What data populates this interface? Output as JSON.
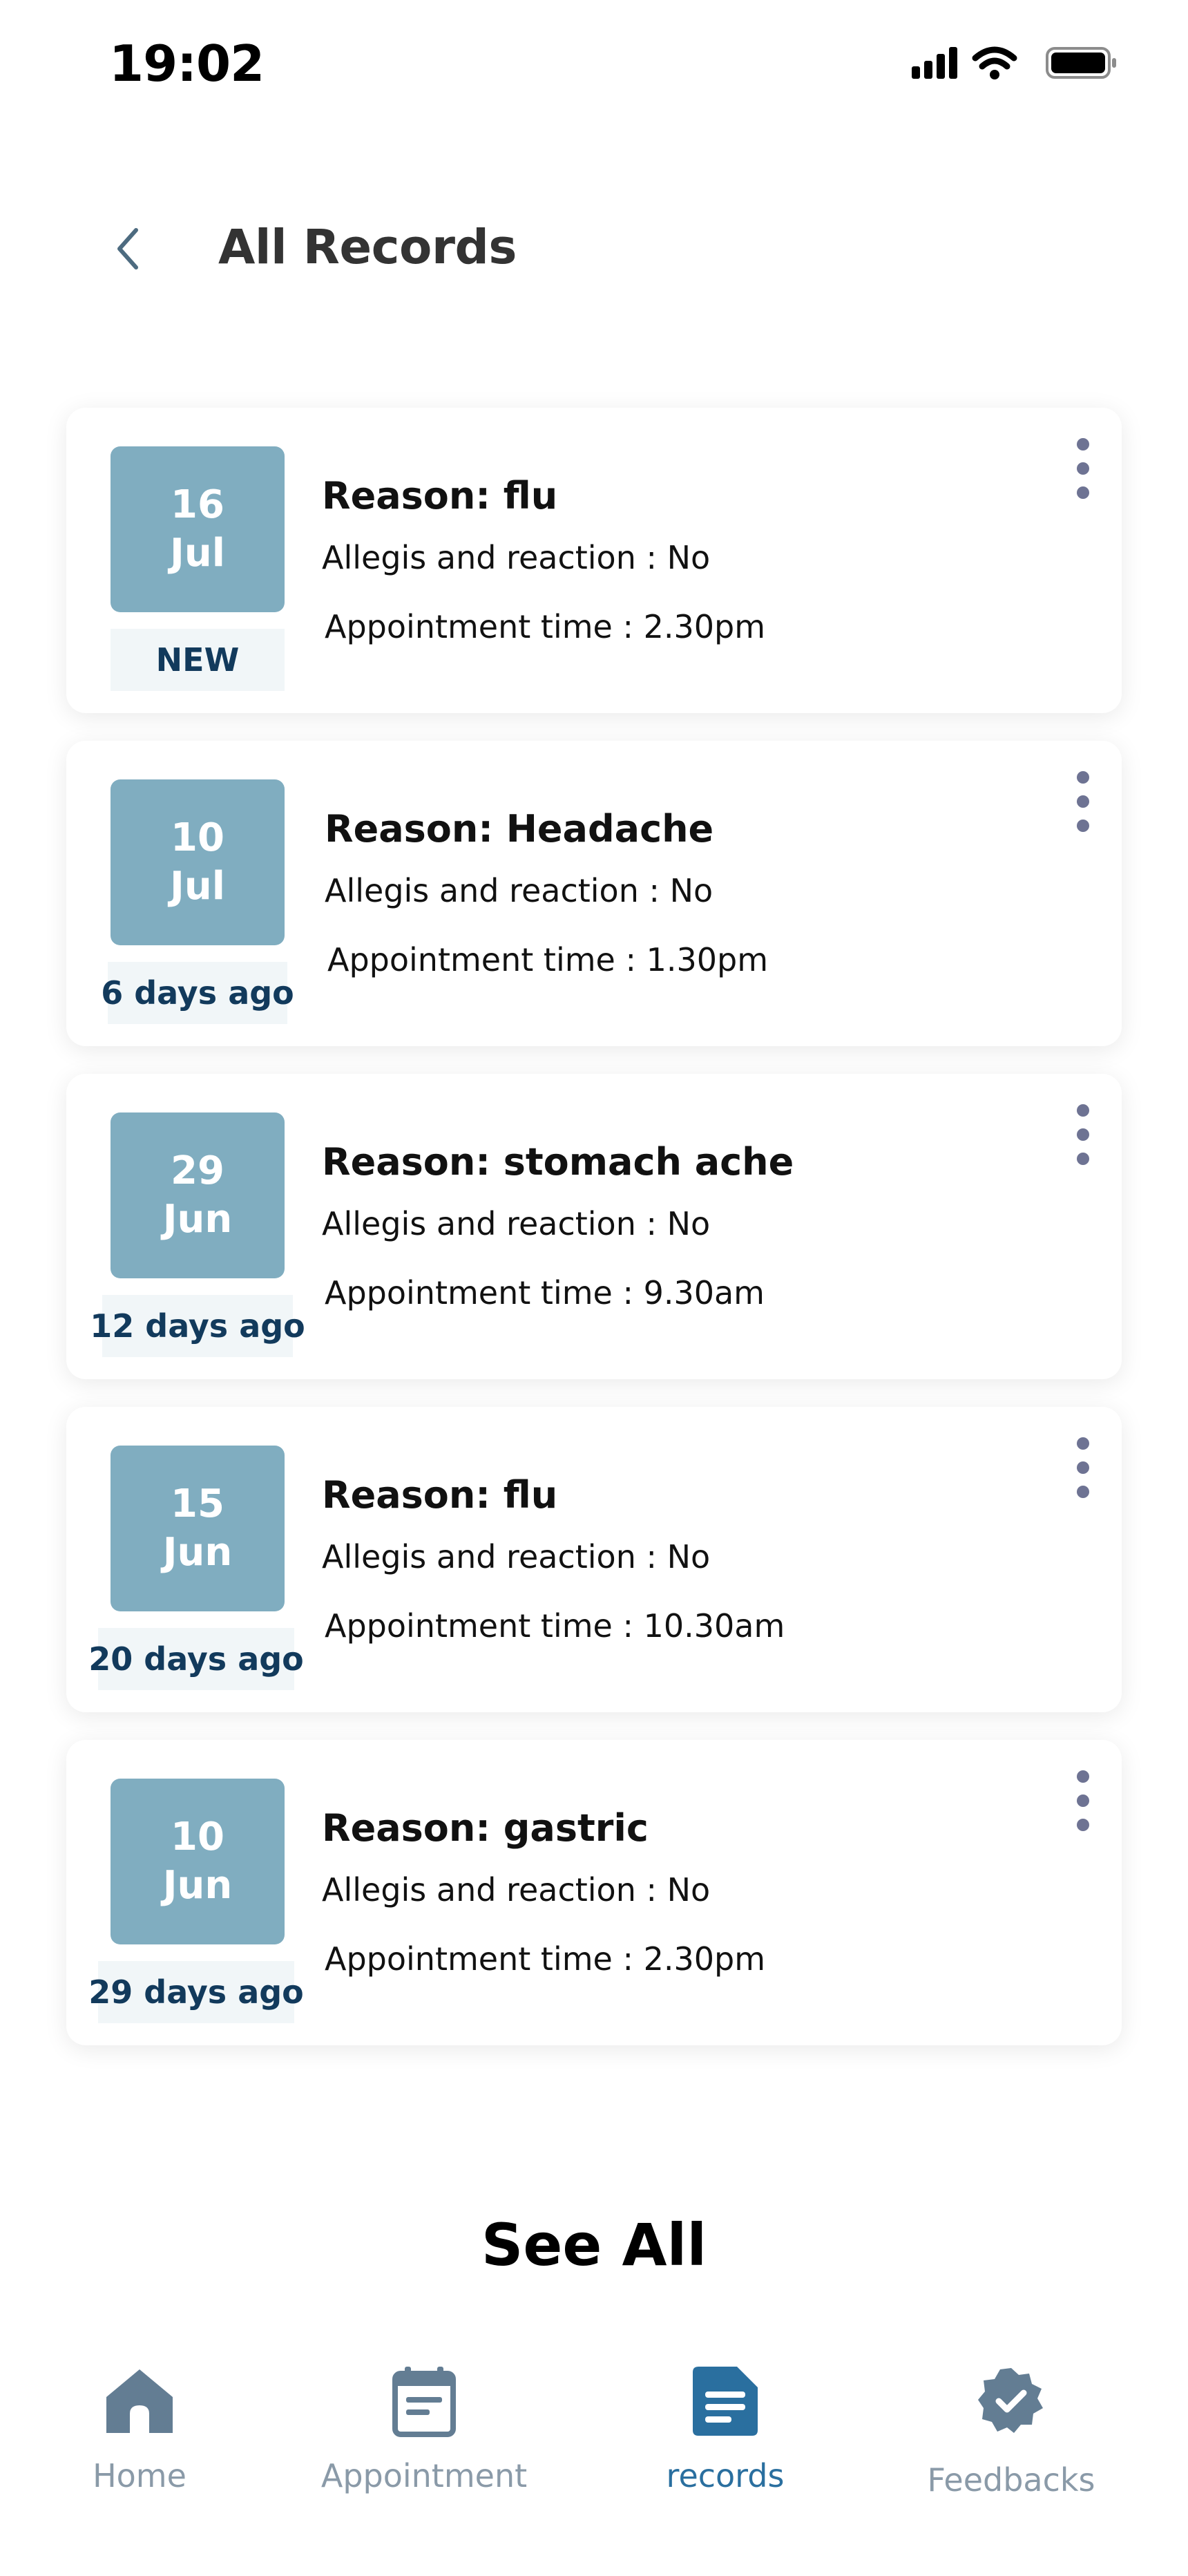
{
  "status_bar": {
    "time": "19:02",
    "icons": [
      "signal-icon",
      "wifi-icon",
      "battery-icon"
    ]
  },
  "header": {
    "back_icon": "chevron-left-icon",
    "title": "All Records"
  },
  "records": [
    {
      "day": "16",
      "month": "Jul",
      "badge": "NEW",
      "reason": "Reason: flu",
      "allergy": "Allegis and reaction : No",
      "appointment": "Appointment time : 2.30pm"
    },
    {
      "day": "10",
      "month": "Jul",
      "badge": "6 days ago",
      "reason": "Reason: Headache",
      "allergy": "Allegis and reaction : No",
      "appointment": "Appointment time : 1.30pm"
    },
    {
      "day": "29",
      "month": "Jun",
      "badge": "12 days ago",
      "reason": "Reason: stomach ache",
      "allergy": "Allegis and reaction : No",
      "appointment": "Appointment time : 9.30am"
    },
    {
      "day": "15",
      "month": "Jun",
      "badge": "20 days ago",
      "reason": "Reason: flu",
      "allergy": "Allegis and reaction : No",
      "appointment": "Appointment time : 10.30am"
    },
    {
      "day": "10",
      "month": "Jun",
      "badge": "29 days ago",
      "reason": "Reason: gastric",
      "allergy": "Allegis and reaction : No",
      "appointment": "Appointment time : 2.30pm"
    }
  ],
  "see_all": "See All",
  "nav": {
    "items": [
      {
        "label": "Home",
        "icon": "home-icon"
      },
      {
        "label": "Appointment",
        "icon": "calendar-icon"
      },
      {
        "label": "records",
        "icon": "document-icon",
        "active": true
      },
      {
        "label": "Feedbacks",
        "icon": "verified-badge-icon"
      }
    ]
  },
  "colors": {
    "date_box": "#80adc0",
    "badge_bg": "#f1f6f8",
    "badge_text": "#123a5c",
    "nav_inactive": "#8a9aa8",
    "nav_active": "#2a6f9f",
    "more_dots": "#6e7393"
  }
}
